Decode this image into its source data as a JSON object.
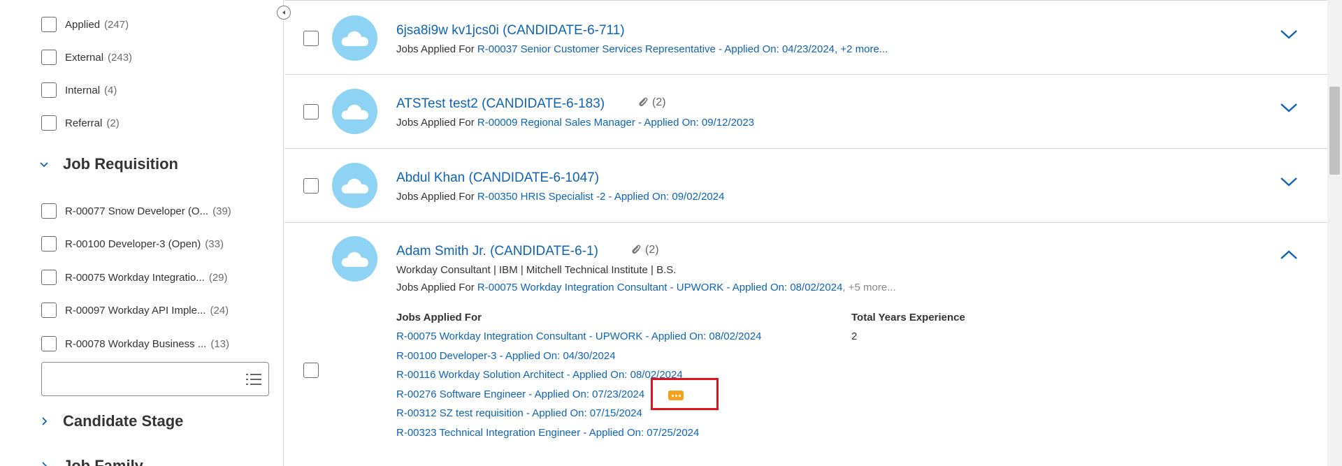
{
  "sidebar": {
    "source_filters": [
      {
        "label": "Applied",
        "count": "(247)"
      },
      {
        "label": "External",
        "count": "(243)"
      },
      {
        "label": "Internal",
        "count": "(4)"
      },
      {
        "label": "Referral",
        "count": "(2)"
      }
    ],
    "job_requisition": {
      "title": "Job Requisition",
      "items": [
        {
          "label": "R-00077 Snow Developer (O...",
          "count": "(39)"
        },
        {
          "label": "R-00100 Developer-3 (Open)",
          "count": "(33)"
        },
        {
          "label": "R-00075 Workday Integratio...",
          "count": "(29)"
        },
        {
          "label": "R-00097 Workday API Imple...",
          "count": "(24)"
        },
        {
          "label": "R-00078 Workday Business ...",
          "count": "(13)"
        }
      ],
      "search_placeholder": ""
    },
    "candidate_stage_title": "Candidate Stage",
    "partial_section_title": "Job Family"
  },
  "candidates": [
    {
      "name": "6jsa8i9w kv1jcs0i (CANDIDATE-6-711)",
      "jobs_prefix": "Jobs Applied For",
      "jobs_link": "R-00037 Senior Customer Services Representative - Applied On: 04/23/2024, +2 more..."
    },
    {
      "name": "ATSTest test2 (CANDIDATE-6-183)",
      "attachments": "(2)",
      "jobs_prefix": "Jobs Applied For",
      "jobs_link": "R-00009 Regional Sales Manager - Applied On: 09/12/2023"
    },
    {
      "name": "Abdul Khan (CANDIDATE-6-1047)",
      "jobs_prefix": "Jobs Applied For",
      "jobs_link": "R-00350 HRIS Specialist -2 - Applied On: 09/02/2024"
    },
    {
      "name": "Adam Smith Jr. (CANDIDATE-6-1)",
      "attachments": "(2)",
      "subtitle": "Workday Consultant | IBM | Mitchell Technical Institute | B.S.",
      "jobs_prefix": "Jobs Applied For",
      "jobs_link": "R-00075 Workday Integration Consultant - UPWORK - Applied On: 08/02/2024",
      "jobs_more": ", +5 more...",
      "detail": {
        "jobs_header": "Jobs Applied For",
        "jobs": [
          "R-00075 Workday Integration Consultant - UPWORK - Applied On: 08/02/2024",
          "R-00100 Developer-3 - Applied On: 04/30/2024",
          "R-00116 Workday Solution Architect - Applied On: 08/02/2024",
          "R-00276 Software Engineer - Applied On: 07/23/2024",
          "R-00312 SZ test requisition - Applied On: 07/15/2024",
          "R-00323 Technical Integration Engineer - Applied On: 07/25/2024"
        ],
        "experience_header": "Total Years Experience",
        "experience_value": "2"
      }
    }
  ],
  "colors": {
    "link": "#0e63b6",
    "avatar": "#8fd3f4",
    "badge": "#f3a11f",
    "highlight": "#e3121b"
  }
}
